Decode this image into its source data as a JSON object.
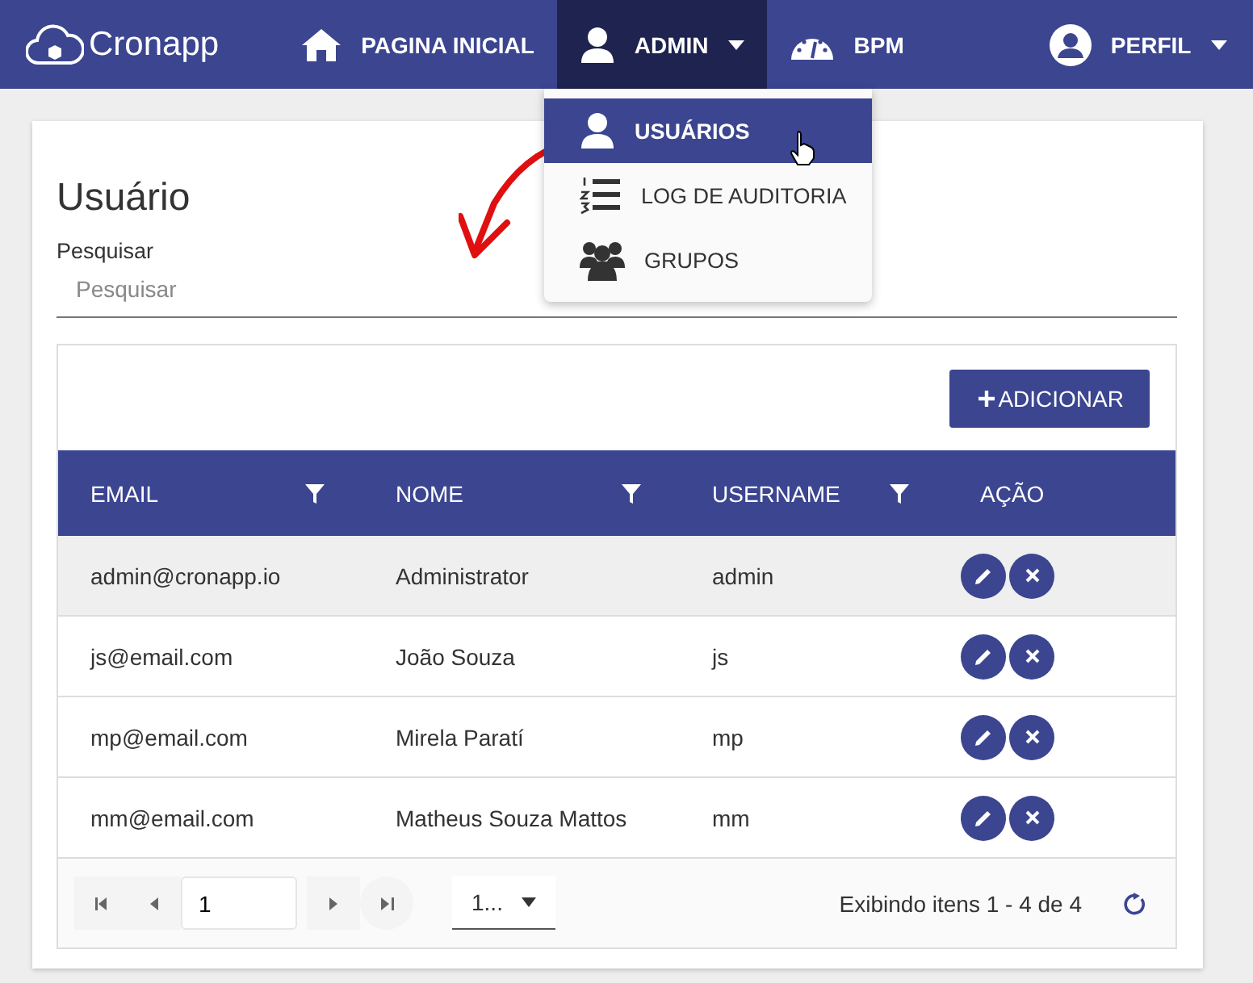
{
  "navbar": {
    "brand": "Cronapp",
    "items": [
      {
        "label": "PAGINA INICIAL",
        "kind": "home",
        "selected": false,
        "caret": false
      },
      {
        "label": "ADMIN",
        "kind": "user",
        "selected": true,
        "caret": true
      },
      {
        "label": "BPM",
        "kind": "gauge",
        "selected": false,
        "caret": false
      }
    ],
    "profile": {
      "label": "PERFIL"
    }
  },
  "dropdown": {
    "items": [
      {
        "label": "USUÁRIOS",
        "kind": "user",
        "selected": true
      },
      {
        "label": "LOG DE AUDITORIA",
        "kind": "list",
        "selected": false
      },
      {
        "label": "GRUPOS",
        "kind": "group",
        "selected": false
      }
    ]
  },
  "page": {
    "title": "Usuário",
    "search_label": "Pesquisar",
    "search": {
      "placeholder": "Pesquisar"
    }
  },
  "grid": {
    "add_button": "ADICIONAR",
    "columns": [
      {
        "label": "EMAIL",
        "filter": true
      },
      {
        "label": "NOME",
        "filter": true
      },
      {
        "label": "USERNAME",
        "filter": true
      },
      {
        "label": "AÇÃO",
        "filter": false
      }
    ],
    "rows": [
      {
        "email": "admin@cronapp.io",
        "nome": "Administrator",
        "username": "admin",
        "selected": true
      },
      {
        "email": "js@email.com",
        "nome": "João Souza",
        "username": "js",
        "selected": false
      },
      {
        "email": "mp@email.com",
        "nome": "Mirela Paratí",
        "username": "mp",
        "selected": false
      },
      {
        "email": "mm@email.com",
        "nome": "Matheus Souza Mattos",
        "username": "mm",
        "selected": false
      }
    ],
    "pager": {
      "page": "1",
      "page_size": "1...",
      "status": "Exibindo itens 1 - 4 de 4"
    }
  }
}
